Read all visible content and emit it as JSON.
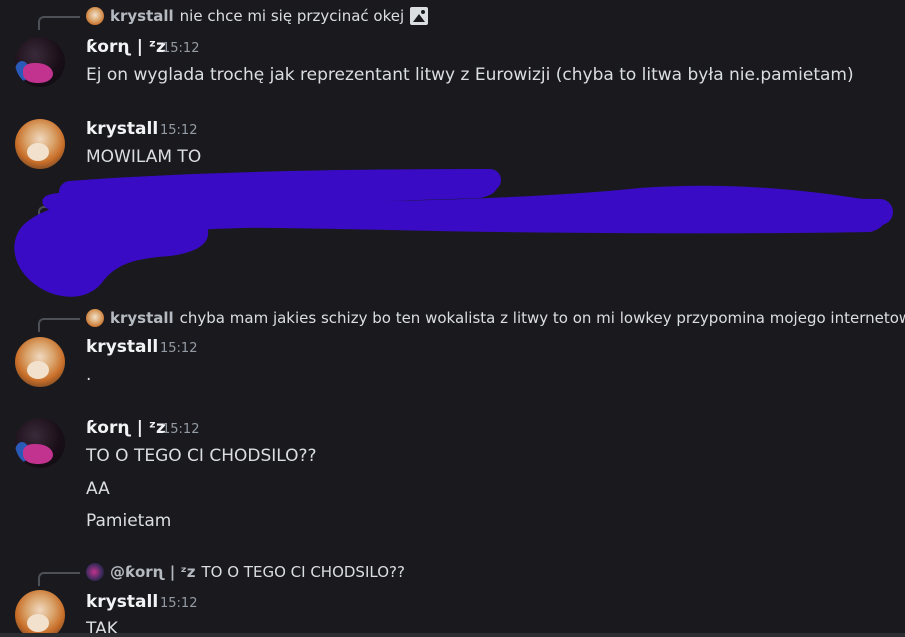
{
  "messages": [
    {
      "reply": {
        "author": "krystall",
        "text": "nie chce mi się przycinać okej"
      },
      "author": "ƙorɳ | ᶻz",
      "time": "15:12",
      "lines": [
        "Ej on wyglada trochę jak reprezentant litwy z Eurowizji (chyba to litwa była nie.pamietam)"
      ]
    },
    {
      "author": "krystall",
      "time": "15:12",
      "lines": [
        "MOWILAM TO"
      ]
    },
    {
      "redacted_tail": "..."
    },
    {
      "reply": {
        "author": "krystall",
        "text": "chyba mam jakies schizy bo ten wokalista z litwy to on mi lowkey przypomina mojego internetow..."
      },
      "author": "krystall",
      "time": "15:12",
      "lines": [
        "."
      ]
    },
    {
      "author": "ƙorɳ | ᶻz",
      "time": "15:12",
      "lines": [
        "TO O TEGO CI CHODSILO??",
        "AA",
        "Pamietam"
      ]
    },
    {
      "reply": {
        "author": "@ƙorɳ | ᶻz",
        "text": "TO O TEGO CI CHODSILO??"
      },
      "author": "krystall",
      "time": "15:12",
      "lines": [
        "TAK"
      ]
    }
  ],
  "colors": {
    "background": "#1a1a1e",
    "scribble": "#3a0bc4",
    "author": "#f2f3f5",
    "timestamp": "#949ba4"
  },
  "icons": {
    "reply_attachment": "image-icon"
  }
}
